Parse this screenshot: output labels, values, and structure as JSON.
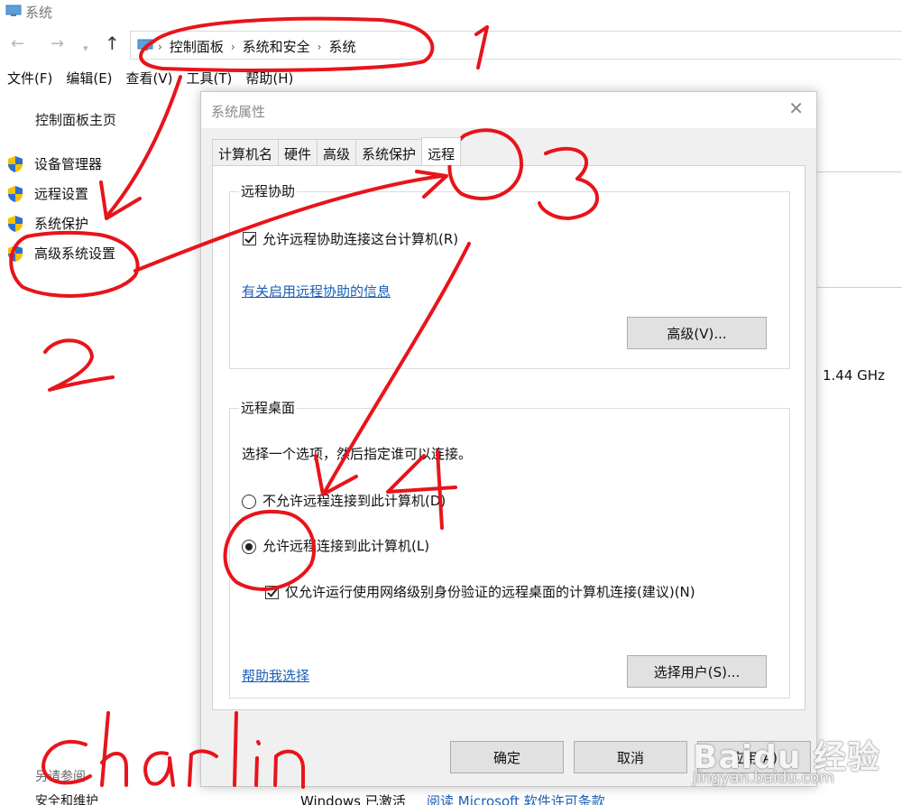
{
  "window": {
    "title": "系统"
  },
  "address": {
    "crumbs": [
      "控制面板",
      "系统和安全",
      "系统"
    ]
  },
  "menu": [
    "文件(F)",
    "编辑(E)",
    "查看(V)",
    "工具(T)",
    "帮助(H)"
  ],
  "sidebar": {
    "home": "控制面板主页",
    "items": [
      "设备管理器",
      "远程设置",
      "系统保护",
      "高级系统设置"
    ],
    "bottom": [
      "另请参阅",
      "安全和维护"
    ]
  },
  "background": {
    "cpu_speed": "1.44 GHz",
    "activated": "Windows 已激活",
    "license_link": "阅读 Microsoft 软件许可条款"
  },
  "dialog": {
    "title": "系统属性",
    "tabs": [
      "计算机名",
      "硬件",
      "高级",
      "系统保护",
      "远程"
    ],
    "active_tab": "远程",
    "assist": {
      "title": "远程协助",
      "checkbox_label": "允许远程协助连接这台计算机(R)",
      "checked": true,
      "info_link": "有关启用远程协助的信息",
      "advanced_button": "高级(V)..."
    },
    "desktop": {
      "title": "远程桌面",
      "instruction": "选择一个选项，然后指定谁可以连接。",
      "option_deny": "不允许远程连接到此计算机(D)",
      "option_allow": "允许远程连接到此计算机(L)",
      "selected": "allow",
      "nla_label": "仅允许运行使用网络级别身份验证的远程桌面的计算机连接(建议)(N)",
      "nla_checked": true,
      "help_link": "帮助我选择",
      "select_users_button": "选择用户(S)..."
    },
    "buttons": {
      "ok": "确定",
      "cancel": "取消",
      "apply": "应用(A)"
    }
  },
  "annotations": {
    "color": "#e8141b",
    "step_numbers": [
      "1",
      "2",
      "3",
      "4"
    ],
    "signature": "Charlin"
  },
  "watermark": {
    "brand": "Baidu 经验",
    "url": "jingyan.baidu.com"
  }
}
